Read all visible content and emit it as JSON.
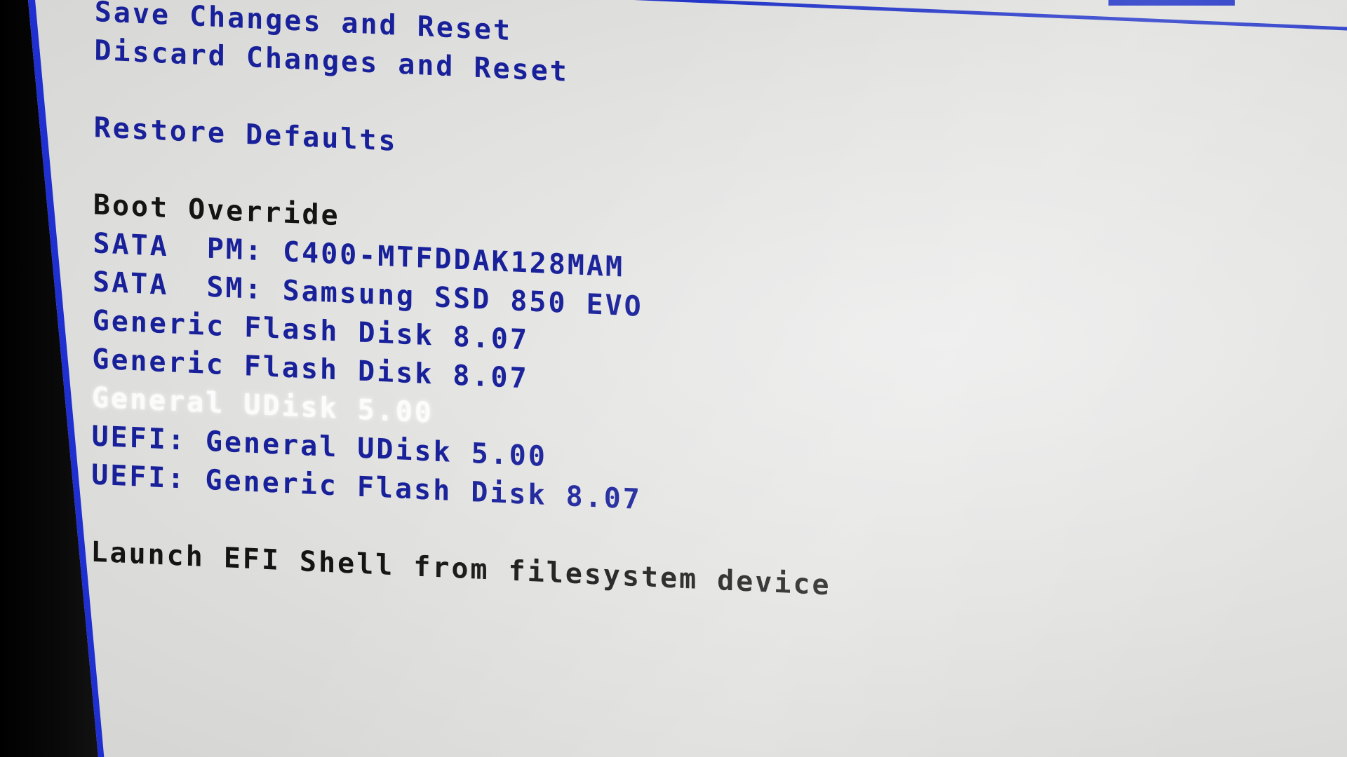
{
  "menu": {
    "save_changes_reset": "Save Changes and Reset",
    "discard_changes_reset": "Discard Changes and Reset",
    "restore_defaults": "Restore Defaults",
    "boot_override_heading": "Boot Override",
    "boot_devices": [
      "SATA  PM: C400-MTFDDAK128MAM",
      "SATA  SM: Samsung SSD 850 EVO",
      "Generic Flash Disk 8.07",
      "Generic Flash Disk 8.07",
      "General UDisk 5.00",
      "UEFI: General UDisk 5.00",
      "UEFI: Generic Flash Disk 8.07"
    ],
    "selected_index": 4,
    "launch_efi_shell": "Launch EFI Shell from filesystem device"
  },
  "colors": {
    "menu_text": "#18209a",
    "heading_text": "#141414",
    "frame_blue": "#1f2fd0",
    "background": "#e4e4e2",
    "selected_text": "#ffffff"
  }
}
